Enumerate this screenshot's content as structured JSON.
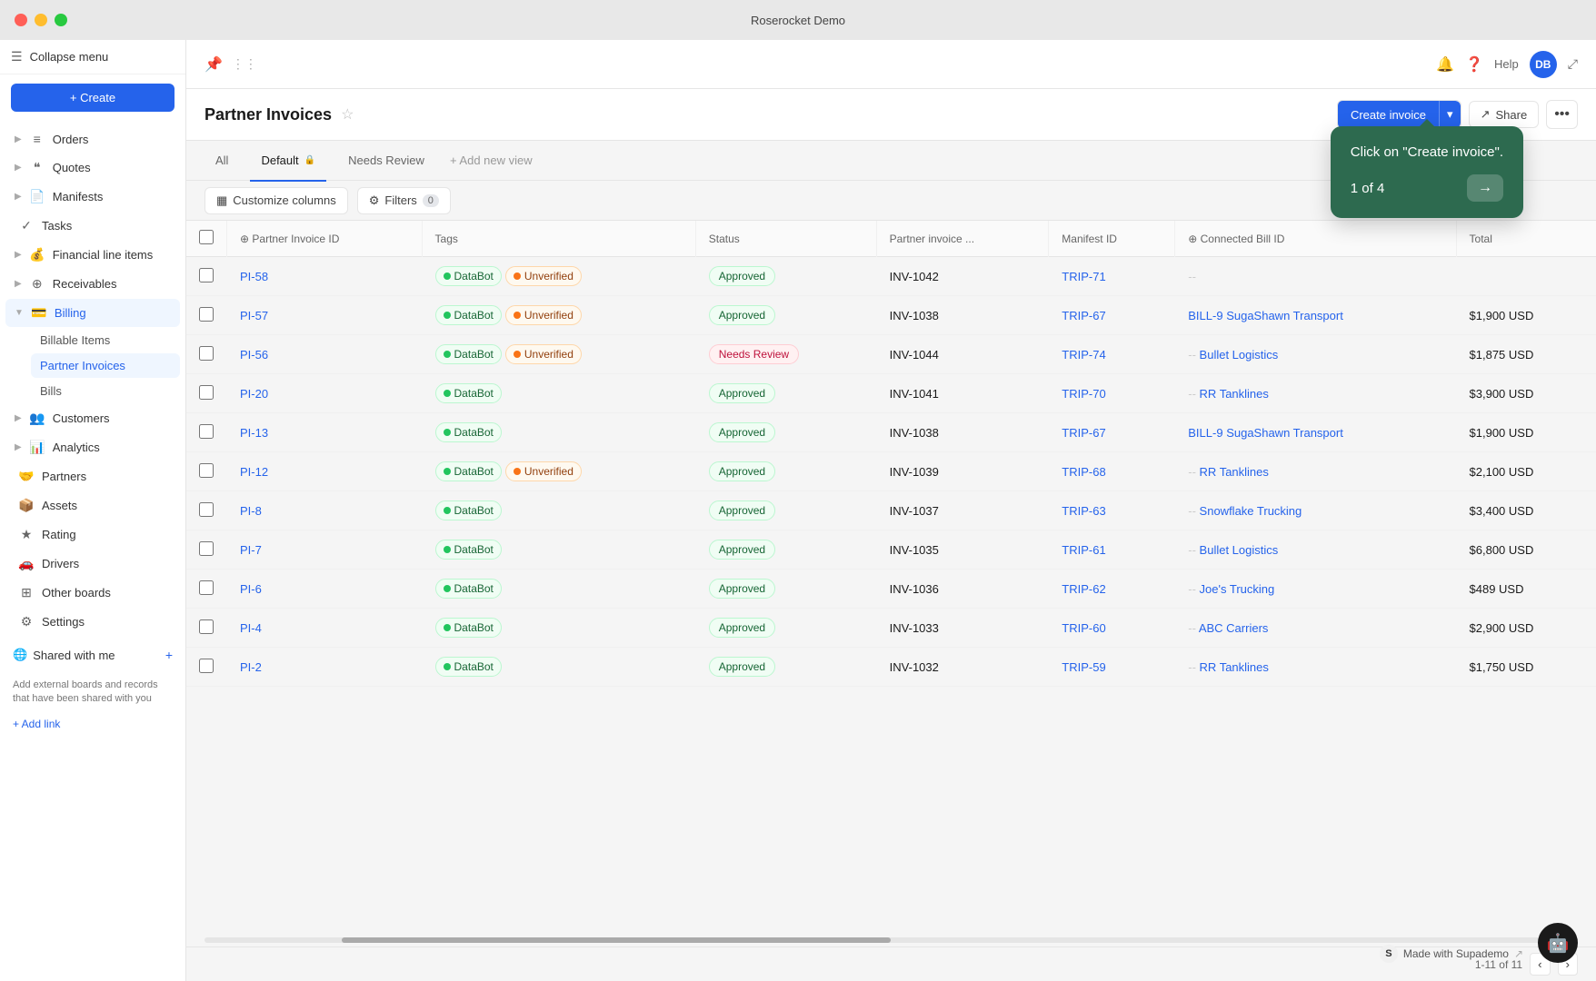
{
  "titlebar": {
    "title": "Roserocket Demo"
  },
  "sidebar": {
    "collapse_label": "Collapse menu",
    "create_label": "+ Create",
    "nav_items": [
      {
        "id": "orders",
        "label": "Orders",
        "icon": "≡",
        "has_chevron": true
      },
      {
        "id": "quotes",
        "label": "Quotes",
        "icon": "❝",
        "has_chevron": true
      },
      {
        "id": "manifests",
        "label": "Manifests",
        "icon": "📄",
        "has_chevron": true
      },
      {
        "id": "tasks",
        "label": "Tasks",
        "icon": "✓",
        "has_chevron": false
      },
      {
        "id": "financial",
        "label": "Financial line items",
        "icon": "₿",
        "has_chevron": true
      },
      {
        "id": "receivables",
        "label": "Receivables",
        "icon": "⊕",
        "has_chevron": true
      },
      {
        "id": "billing",
        "label": "Billing",
        "icon": "💳",
        "has_chevron": true,
        "active": true
      },
      {
        "id": "customers",
        "label": "Customers",
        "icon": "👥",
        "has_chevron": true
      },
      {
        "id": "analytics",
        "label": "Analytics",
        "icon": "📊",
        "has_chevron": true
      },
      {
        "id": "partners",
        "label": "Partners",
        "icon": "🤝",
        "has_chevron": false
      },
      {
        "id": "assets",
        "label": "Assets",
        "icon": "📦",
        "has_chevron": false
      },
      {
        "id": "rating",
        "label": "Rating",
        "icon": "★",
        "has_chevron": false
      },
      {
        "id": "drivers",
        "label": "Drivers",
        "icon": "🚗",
        "has_chevron": false
      },
      {
        "id": "other-boards",
        "label": "Other boards",
        "icon": "⊞",
        "has_chevron": false
      },
      {
        "id": "settings",
        "label": "Settings",
        "icon": "⚙",
        "has_chevron": false
      }
    ],
    "billing_sub": [
      {
        "id": "billable-items",
        "label": "Billable Items"
      },
      {
        "id": "partner-invoices",
        "label": "Partner Invoices",
        "active": true
      },
      {
        "id": "bills",
        "label": "Bills"
      }
    ],
    "shared_with_me": "Shared with me",
    "shared_note": "Add external boards and records that have been shared with you",
    "add_link": "+ Add link"
  },
  "topbar": {
    "page_title": "Partner Invoices",
    "help_label": "Help",
    "avatar_initials": "DB"
  },
  "tabs": [
    {
      "id": "all",
      "label": "All",
      "active": false
    },
    {
      "id": "default",
      "label": "Default",
      "active": true,
      "has_lock": true
    },
    {
      "id": "needs-review",
      "label": "Needs Review",
      "active": false
    }
  ],
  "add_view_label": "+ Add new view",
  "action_bar": {
    "customize_columns": "Customize columns",
    "filters": "Filters",
    "filter_count": "0",
    "create_invoice": "Create invoice",
    "share": "Share",
    "more": "•••"
  },
  "table": {
    "columns": [
      {
        "id": "check",
        "label": ""
      },
      {
        "id": "pi-id",
        "label": "Partner Invoice ID"
      },
      {
        "id": "tags",
        "label": "Tags"
      },
      {
        "id": "status",
        "label": "Status"
      },
      {
        "id": "partner-invoice",
        "label": "Partner invoice ..."
      },
      {
        "id": "manifest-id",
        "label": "Manifest ID"
      },
      {
        "id": "connected-bill",
        "label": "Connected Bill ID"
      },
      {
        "id": "total",
        "label": "Total"
      }
    ],
    "rows": [
      {
        "id": "PI-58",
        "tags": [
          {
            "label": "DataBot",
            "type": "databot"
          },
          {
            "label": "Unverified",
            "type": "unverified"
          }
        ],
        "status": "Approved",
        "partner_invoice": "INV-1042",
        "manifest_id": "TRIP-71",
        "connected_bill": "--",
        "total": ""
      },
      {
        "id": "PI-57",
        "tags": [
          {
            "label": "DataBot",
            "type": "databot"
          },
          {
            "label": "Unverified",
            "type": "unverified"
          }
        ],
        "status": "Approved",
        "partner_invoice": "INV-1038",
        "manifest_id": "TRIP-67",
        "connected_bill": "BILL-9",
        "connected_company": "SugaShawn Transport",
        "total": "$1,900 USD"
      },
      {
        "id": "PI-56",
        "tags": [
          {
            "label": "DataBot",
            "type": "databot"
          },
          {
            "label": "Unverified",
            "type": "unverified"
          }
        ],
        "status": "Needs Review",
        "partner_invoice": "INV-1044",
        "manifest_id": "TRIP-74",
        "connected_bill": "--",
        "connected_company": "Bullet Logistics",
        "total": "$1,875 USD"
      },
      {
        "id": "PI-20",
        "tags": [
          {
            "label": "DataBot",
            "type": "databot"
          }
        ],
        "status": "Approved",
        "partner_invoice": "INV-1041",
        "manifest_id": "TRIP-70",
        "connected_bill": "--",
        "connected_company": "RR Tanklines",
        "total": "$3,900 USD"
      },
      {
        "id": "PI-13",
        "tags": [
          {
            "label": "DataBot",
            "type": "databot"
          }
        ],
        "status": "Approved",
        "partner_invoice": "INV-1038",
        "manifest_id": "TRIP-67",
        "connected_bill": "BILL-9",
        "connected_company": "SugaShawn Transport",
        "total": "$1,900 USD"
      },
      {
        "id": "PI-12",
        "tags": [
          {
            "label": "DataBot",
            "type": "databot"
          },
          {
            "label": "Unverified",
            "type": "unverified"
          }
        ],
        "status": "Approved",
        "partner_invoice": "INV-1039",
        "manifest_id": "TRIP-68",
        "connected_bill": "--",
        "connected_company": "RR Tanklines",
        "total": "$2,100 USD"
      },
      {
        "id": "PI-8",
        "tags": [
          {
            "label": "DataBot",
            "type": "databot"
          }
        ],
        "status": "Approved",
        "partner_invoice": "INV-1037",
        "manifest_id": "TRIP-63",
        "connected_bill": "--",
        "connected_company": "Snowflake Trucking",
        "total": "$3,400 USD"
      },
      {
        "id": "PI-7",
        "tags": [
          {
            "label": "DataBot",
            "type": "databot"
          }
        ],
        "status": "Approved",
        "partner_invoice": "INV-1035",
        "manifest_id": "TRIP-61",
        "connected_bill": "--",
        "connected_company": "Bullet Logistics",
        "total": "$6,800 USD"
      },
      {
        "id": "PI-6",
        "tags": [
          {
            "label": "DataBot",
            "type": "databot"
          }
        ],
        "status": "Approved",
        "partner_invoice": "INV-1036",
        "manifest_id": "TRIP-62",
        "connected_bill": "--",
        "connected_company": "Joe's Trucking",
        "total": "$489 USD"
      },
      {
        "id": "PI-4",
        "tags": [
          {
            "label": "DataBot",
            "type": "databot"
          }
        ],
        "status": "Approved",
        "partner_invoice": "INV-1033",
        "manifest_id": "TRIP-60",
        "connected_bill": "--",
        "connected_company": "ABC Carriers",
        "total": "$2,900 USD"
      },
      {
        "id": "PI-2",
        "tags": [
          {
            "label": "DataBot",
            "type": "databot"
          }
        ],
        "status": "Approved",
        "partner_invoice": "INV-1032",
        "manifest_id": "TRIP-59",
        "connected_bill": "--",
        "connected_company": "RR Tanklines",
        "total": "$1,750 USD"
      }
    ]
  },
  "tooltip": {
    "text": "Click on \"Create invoice\".",
    "counter": "1 of 4",
    "arrow_label": "→"
  },
  "pagination": {
    "count_label": "1-11 of 11",
    "prev_label": "‹",
    "next_label": "›"
  },
  "supademo": {
    "label": "Made with Supademo",
    "icon": "S",
    "external_icon": "↗"
  }
}
